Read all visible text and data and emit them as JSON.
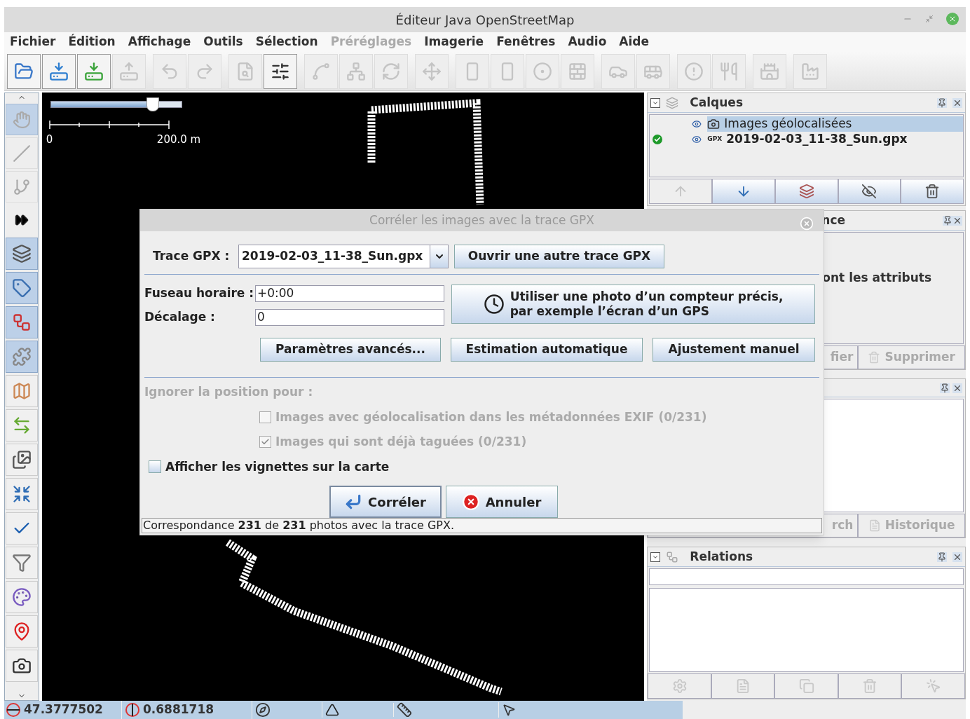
{
  "window": {
    "title": "Éditeur Java OpenStreetMap"
  },
  "menu": [
    {
      "label": "Fichier",
      "disabled": false
    },
    {
      "label": "Édition",
      "disabled": false
    },
    {
      "label": "Affichage",
      "disabled": false
    },
    {
      "label": "Outils",
      "disabled": false
    },
    {
      "label": "Sélection",
      "disabled": false
    },
    {
      "label": "Préréglages",
      "disabled": true
    },
    {
      "label": "Imagerie",
      "disabled": false
    },
    {
      "label": "Fenêtres",
      "disabled": false
    },
    {
      "label": "Audio",
      "disabled": false
    },
    {
      "label": "Aide",
      "disabled": false
    }
  ],
  "toolbar": [
    [
      {
        "disabled": false
      },
      {
        "disabled": false
      },
      {
        "disabled": false
      },
      {
        "disabled": true
      }
    ],
    [
      {
        "disabled": true
      },
      {
        "disabled": true
      }
    ],
    [
      {
        "disabled": true
      },
      {
        "disabled": false
      }
    ],
    [
      {
        "disabled": true
      },
      {
        "disabled": true
      },
      {
        "disabled": true
      }
    ],
    [
      {
        "disabled": true
      }
    ],
    [
      {
        "disabled": true
      },
      {
        "disabled": true
      },
      {
        "disabled": true
      },
      {
        "disabled": true
      }
    ],
    [
      {
        "disabled": true
      },
      {
        "disabled": true
      }
    ],
    [
      {
        "disabled": true
      },
      {
        "disabled": true
      }
    ],
    [
      {
        "disabled": true
      }
    ],
    [
      {
        "disabled": true
      }
    ]
  ],
  "modes": [
    {
      "selected": true,
      "disabled": true
    },
    {
      "selected": false,
      "disabled": true
    },
    {
      "selected": false,
      "disabled": true
    }
  ],
  "panels": [
    {
      "selected": true
    },
    {
      "selected": true
    },
    {
      "selected": true
    },
    {
      "selected": true
    },
    {
      "selected": false
    },
    {
      "selected": false
    },
    {
      "selected": false
    },
    {
      "selected": false
    },
    {
      "selected": false
    },
    {
      "selected": false
    },
    {
      "selected": false
    },
    {
      "selected": false
    },
    {
      "selected": false
    }
  ],
  "map": {
    "zoom_slider": {
      "level": 0.78
    },
    "scale": {
      "start": "0",
      "end": "200.0 m"
    }
  },
  "layers_panel": {
    "title": "Calques",
    "layers": [
      {
        "name": "Images géolocalisées",
        "kind": "images",
        "selected": true,
        "active": false
      },
      {
        "name": "2019-02-03_11-38_Sun.gpx",
        "kind": "gpx",
        "badge": "GPX",
        "selected": false,
        "active": true
      }
    ],
    "buttons": [
      {
        "disabled": true
      },
      {
        "disabled": false
      },
      {
        "disabled": false
      },
      {
        "disabled": false
      },
      {
        "disabled": false
      }
    ]
  },
  "tags_panel": {
    "title": "nce",
    "text": "ont les attributs",
    "buttons": [
      {
        "label": "fier",
        "disabled": true
      },
      {
        "label": "Supprimer",
        "disabled": true
      }
    ]
  },
  "third_panel": {
    "buttons": [
      {
        "label": "rch",
        "disabled": true
      },
      {
        "label": "Historique",
        "disabled": true
      }
    ]
  },
  "relations_panel": {
    "title": "Relations",
    "buttons": [
      {
        "disabled": true
      },
      {
        "disabled": true
      },
      {
        "disabled": true
      },
      {
        "disabled": true
      },
      {
        "disabled": true
      }
    ]
  },
  "dialog": {
    "title": "Corréler les images avec la trace GPX",
    "track_label": "Trace GPX :",
    "track_value": "2019-02-03_11-38_Sun.gpx",
    "open_track_button": "Ouvrir une autre trace GPX",
    "fields": [
      {
        "label": "Fuseau horaire :",
        "value": "+0:00"
      },
      {
        "label": "Décalage :",
        "value": "0"
      }
    ],
    "photo_button": [
      "Utiliser une photo d’un compteur précis,",
      "par exemple l’écran d’un GPS"
    ],
    "actions": [
      "Paramètres avancés...",
      "Estimation automatique",
      "Ajustement manuel"
    ],
    "ignore_label": "Ignorer la position pour :",
    "ignore_options": [
      {
        "label": "Images avec géolocalisation dans les métadonnées EXIF (0/231)",
        "checked": false,
        "disabled": true
      },
      {
        "label": "Images qui sont déjà taguées (0/231)",
        "checked": true,
        "disabled": true
      }
    ],
    "thumbnails": {
      "label": "Afficher les vignettes sur la carte",
      "checked": false
    },
    "buttons": [
      {
        "label": "Corréler",
        "kind": "ok"
      },
      {
        "label": "Annuler",
        "kind": "cancel"
      }
    ],
    "status": "Correspondance **231** de **231** photos avec la trace GPX."
  },
  "status_bar": {
    "lat": "47.3777502",
    "lon": "0.6881718"
  }
}
